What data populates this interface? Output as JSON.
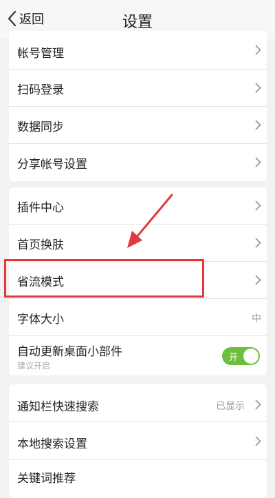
{
  "header": {
    "back_label": "返回",
    "title": "设置"
  },
  "groups": [
    {
      "items": [
        {
          "label": "帐号管理"
        },
        {
          "label": "扫码登录"
        },
        {
          "label": "数据同步"
        },
        {
          "label": "分享帐号设置"
        }
      ]
    },
    {
      "items": [
        {
          "label": "插件中心"
        },
        {
          "label": "首页换肤"
        },
        {
          "label": "省流模式",
          "highlighted": true
        },
        {
          "label": "字体大小",
          "value": "中"
        },
        {
          "label": "自动更新桌面小部件",
          "sublabel": "建议开启",
          "toggle": {
            "state": "on",
            "text": "开"
          }
        }
      ]
    },
    {
      "items": [
        {
          "label": "通知栏快速搜索",
          "value": "已显示"
        },
        {
          "label": "本地搜索设置"
        },
        {
          "label": "关键词推荐"
        }
      ]
    }
  ],
  "colors": {
    "accent_toggle": "#6cbf3d",
    "annotation_red": "#e0383e",
    "background": "#f2f2f2"
  }
}
